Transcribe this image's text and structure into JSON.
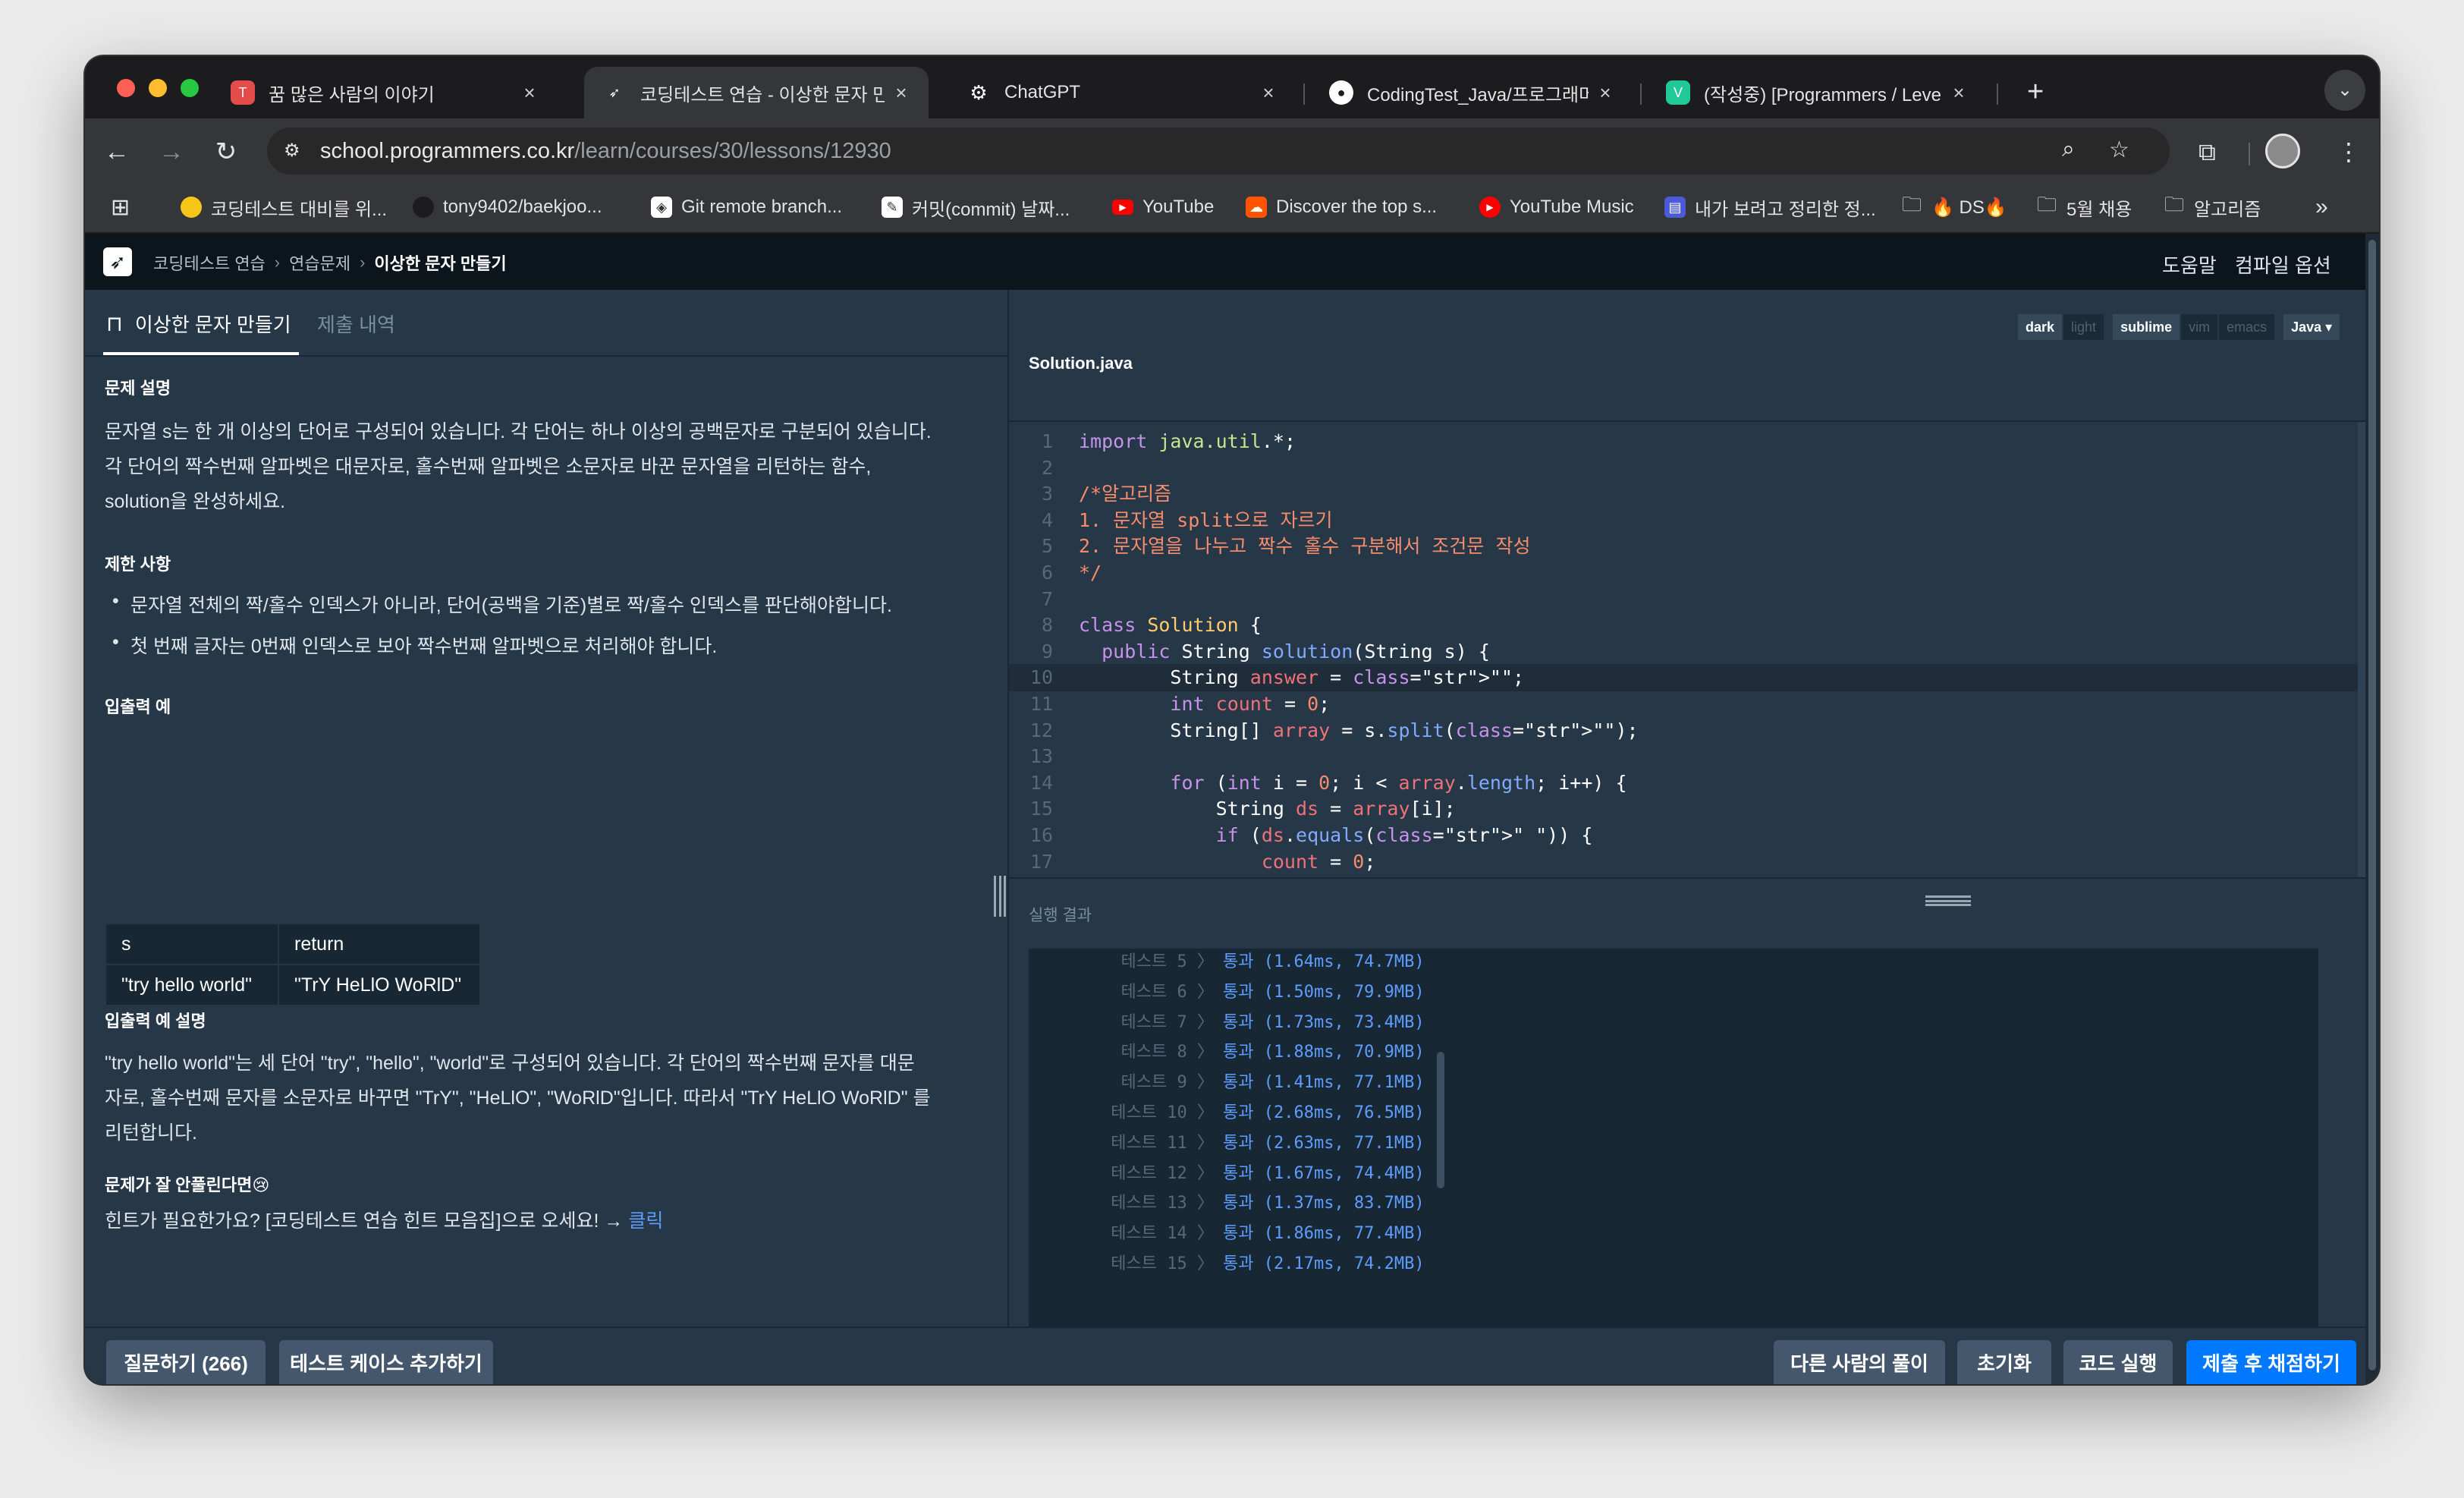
{
  "browser": {
    "tabs": [
      {
        "title": "꿈 많은 사람의 이야기",
        "favicon": "tistory-icon",
        "color": "#e44b4b",
        "glyph": "T"
      },
      {
        "title": "코딩테스트 연습 - 이상한 문자 만들",
        "favicon": "programmers-icon",
        "color": "#35363a",
        "glyph": "➶"
      },
      {
        "title": "ChatGPT",
        "favicon": "chatgpt-icon",
        "color": "#1c1c1e",
        "glyph": "⚙"
      },
      {
        "title": "CodingTest_Java/프로그래머스/",
        "favicon": "github-icon",
        "color": "#1c1c1e",
        "glyph": "●"
      },
      {
        "title": "(작성중) [Programmers / Level",
        "favicon": "velog-icon",
        "color": "#20c997",
        "glyph": "V"
      }
    ],
    "url_host": "school.programmers.co.kr",
    "url_path": "/learn/courses/30/lessons/12930",
    "bookmarks": [
      {
        "label": "코딩테스트 대비를 위...",
        "icon": "emoji-icon"
      },
      {
        "label": "tony9402/baekjoo...",
        "icon": "github-icon"
      },
      {
        "label": "Git remote branch...",
        "icon": "git-icon"
      },
      {
        "label": "커밋(commit) 날짜...",
        "icon": "page-icon"
      },
      {
        "label": "YouTube",
        "icon": "youtube-icon"
      },
      {
        "label": "Discover the top s...",
        "icon": "soundcloud-icon"
      },
      {
        "label": "YouTube Music",
        "icon": "youtube-music-icon"
      },
      {
        "label": "내가 보려고 정리한 정...",
        "icon": "page-icon"
      },
      {
        "label": "🔥 DS🔥",
        "icon": "folder-icon"
      },
      {
        "label": "5월 채용",
        "icon": "folder-icon"
      },
      {
        "label": "알고리즘",
        "icon": "folder-icon"
      }
    ]
  },
  "page": {
    "breadcrumb": [
      "코딩테스트 연습",
      "연습문제",
      "이상한 문자 만들기"
    ],
    "help": "도움말",
    "compile_options": "컴파일 옵션",
    "tabs": {
      "problem": "이상한 문자 만들기",
      "submissions": "제출 내역"
    },
    "description_title": "문제 설명",
    "description": [
      "문자열 s는 한 개 이상의 단어로 구성되어 있습니다. 각 단어는 하나 이상의 공백문자로 구분되어 있습니다.",
      "각 단어의 짝수번째 알파벳은 대문자로, 홀수번째 알파벳은 소문자로 바꾼 문자열을 리턴하는 함수,",
      "solution을 완성하세요."
    ],
    "constraints_title": "제한 사항",
    "constraints": [
      "문자열 전체의 짝/홀수 인덱스가 아니라, 단어(공백을 기준)별로 짝/홀수 인덱스를 판단해야합니다.",
      "첫 번째 글자는 0번째 인덱스로 보아 짝수번째 알파벳으로 처리해야 합니다."
    ],
    "io_title": "입출력 예",
    "io_headers": [
      "s",
      "return"
    ],
    "io_row": [
      "\"try hello world\"",
      "\"TrY HeLlO WoRlD\""
    ],
    "io_explain_title": "입출력 예 설명",
    "io_explain": [
      "\"try hello world\"는 세 단어 \"try\", \"hello\", \"world\"로 구성되어 있습니다. 각 단어의 짝수번째 문자를 대문",
      "자로, 홀수번째 문자를 소문자로 바꾸면 \"TrY\", \"HeLlO\", \"WoRlD\"입니다. 따라서 \"TrY HeLlO WoRlD\" 를",
      "리턴합니다."
    ],
    "hint_title": "문제가 잘 안풀린다면😢",
    "hint_text": "힌트가 필요한가요? [코딩테스트 연습 힌트 모음집]으로 오세요! → ",
    "hint_link": "클릭"
  },
  "editor": {
    "filename": "Solution.java",
    "theme_options": [
      "dark",
      "light"
    ],
    "keymap_options": [
      "sublime",
      "vim",
      "emacs"
    ],
    "language": "Java",
    "lines": [
      "import java.util.*;",
      "",
      "/*알고리즘",
      "1. 문자열 split으로 자르기",
      "2. 문자열을 나누고 짝수 홀수 구분해서 조건문 작성",
      "*/",
      "",
      "class Solution {",
      "  public String solution(String s) {",
      "        String answer = \"\";",
      "        int count = 0;",
      "        String[] array = s.split(\"\");",
      "",
      "        for (int i = 0; i < array.length; i++) {",
      "            String ds = array[i];",
      "            if (ds.equals(\" \")) {",
      "                count = 0;"
    ]
  },
  "results": {
    "title": "실행 결과",
    "rows": [
      {
        "label": "테스트 5 〉",
        "value": "통과 (1.64ms, 74.7MB)"
      },
      {
        "label": "테스트 6 〉",
        "value": "통과 (1.50ms, 79.9MB)"
      },
      {
        "label": "테스트 7 〉",
        "value": "통과 (1.73ms, 73.4MB)"
      },
      {
        "label": "테스트 8 〉",
        "value": "통과 (1.88ms, 70.9MB)"
      },
      {
        "label": "테스트 9 〉",
        "value": "통과 (1.41ms, 77.1MB)"
      },
      {
        "label": "테스트 10 〉",
        "value": "통과 (2.68ms, 76.5MB)"
      },
      {
        "label": "테스트 11 〉",
        "value": "통과 (2.63ms, 77.1MB)"
      },
      {
        "label": "테스트 12 〉",
        "value": "통과 (1.67ms, 74.4MB)"
      },
      {
        "label": "테스트 13 〉",
        "value": "통과 (1.37ms, 83.7MB)"
      },
      {
        "label": "테스트 14 〉",
        "value": "통과 (1.86ms, 77.4MB)"
      },
      {
        "label": "테스트 15 〉",
        "value": "통과 (2.17ms, 74.2MB)"
      }
    ]
  },
  "footer": {
    "ask": "질문하기 (266)",
    "add_testcase": "테스트 케이스 추가하기",
    "others": "다른 사람의 풀이",
    "reset": "초기화",
    "run": "코드 실행",
    "submit": "제출 후 채점하기"
  },
  "colors": {
    "accent": "#0078ff",
    "pass": "#5e9dff",
    "bg": "#263747",
    "header": "#0c151c"
  }
}
